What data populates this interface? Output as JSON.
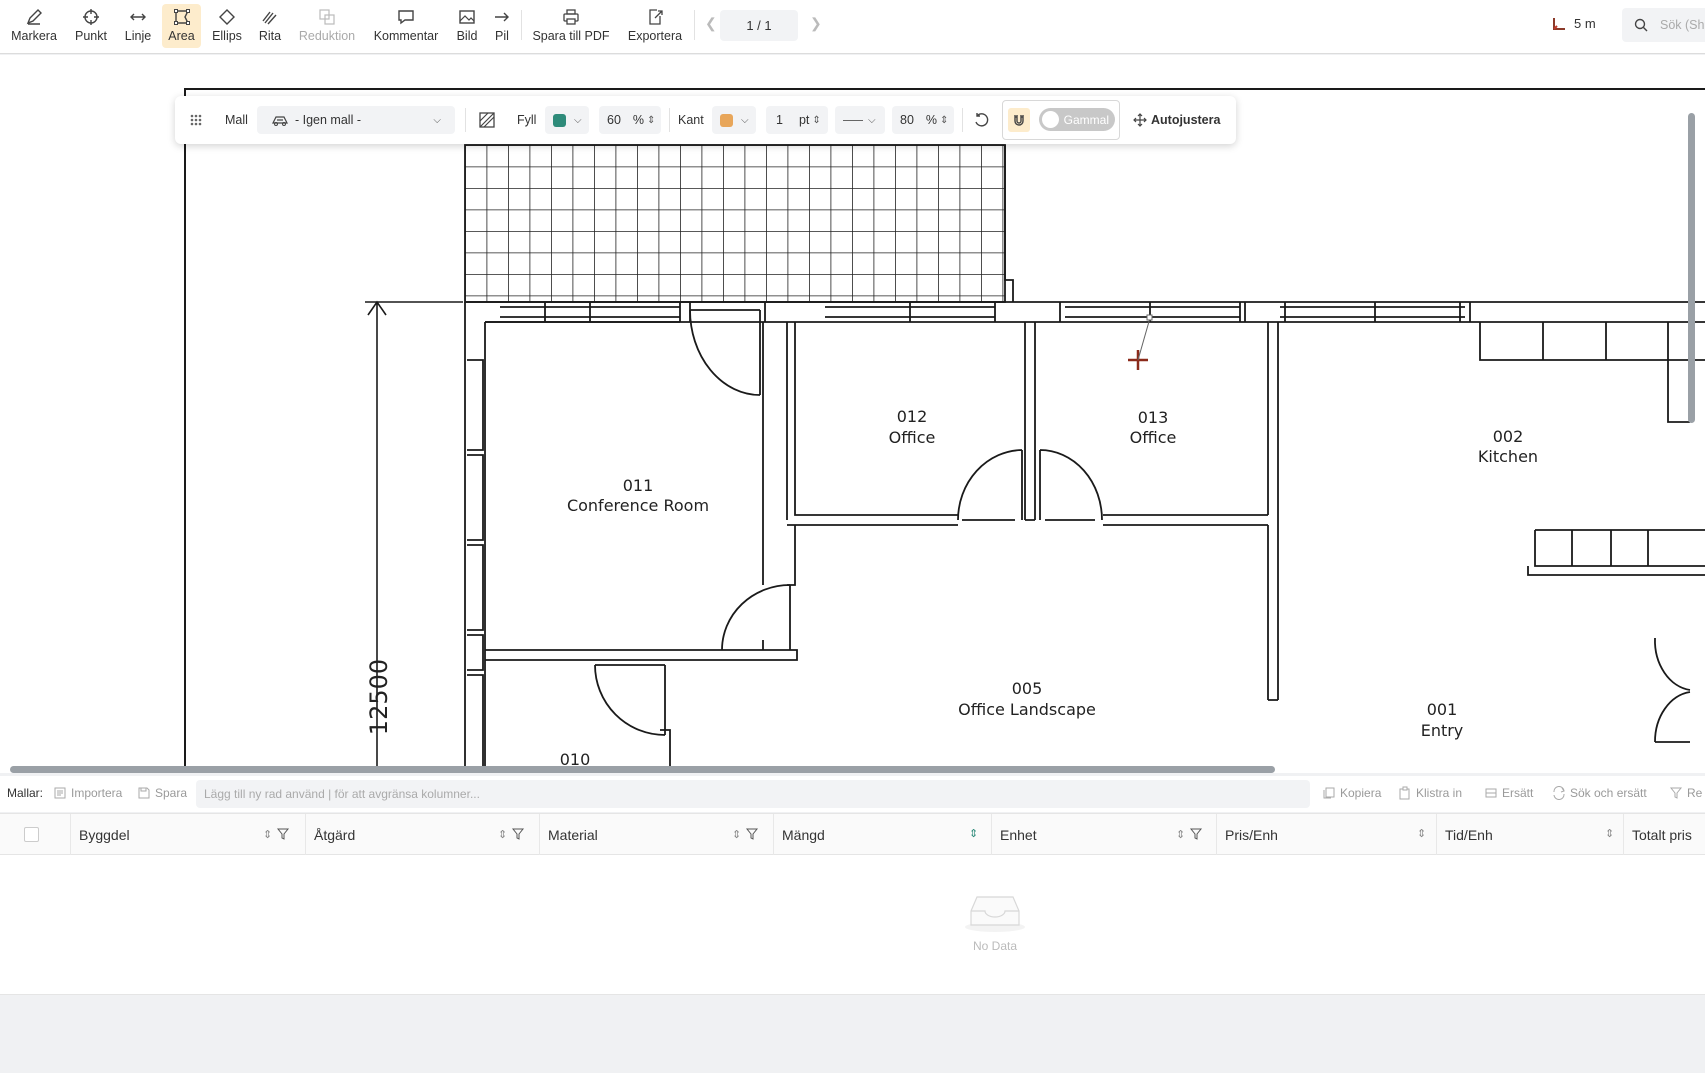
{
  "toolbar": {
    "tools": [
      {
        "label": "Markera",
        "icon": "pen-icon"
      },
      {
        "label": "Punkt",
        "icon": "crosshair-icon"
      },
      {
        "label": "Linje",
        "icon": "line-arrows-icon"
      },
      {
        "label": "Area",
        "icon": "area-polygon-icon",
        "active": true
      },
      {
        "label": "Ellips",
        "icon": "ellipse-icon"
      },
      {
        "label": "Rita",
        "icon": "draw-icon"
      },
      {
        "label": "Reduktion",
        "icon": "reduction-icon",
        "disabled": true
      },
      {
        "label": "Kommentar",
        "icon": "comment-icon"
      },
      {
        "label": "Bild",
        "icon": "image-icon"
      },
      {
        "label": "Pil",
        "icon": "arrow-icon"
      },
      {
        "label": "Spara till PDF",
        "icon": "printer-icon"
      },
      {
        "label": "Exportera",
        "icon": "export-icon"
      }
    ],
    "page_indicator": "1 / 1",
    "scale": "5 m",
    "search_placeholder": "Sök (Shift+F)"
  },
  "property_bar": {
    "template_label": "Mall",
    "template_value": "- Igen mall -",
    "fill_label": "Fyll",
    "fill_color": "#2e8b7a",
    "fill_opacity": "60",
    "percent": "%",
    "border_label": "Kant",
    "border_color": "#e8a65a",
    "border_width": "1",
    "border_unit": "pt",
    "border_opacity": "80",
    "toggle_label": "Gammal",
    "autofit_label": "Autojustera"
  },
  "floorplan": {
    "dimension": "12500",
    "rooms": [
      {
        "number": "011",
        "name": "Conference Room"
      },
      {
        "number": "012",
        "name": "Office"
      },
      {
        "number": "013",
        "name": "Office"
      },
      {
        "number": "002",
        "name": "Kitchen"
      },
      {
        "number": "005",
        "name": "Office Landscape"
      },
      {
        "number": "001",
        "name": "Entry"
      },
      {
        "number": "010",
        "name": ""
      }
    ]
  },
  "templates_bar": {
    "label": "Mallar:",
    "import": "Importera",
    "save": "Spara",
    "new_row_placeholder": "Lägg till ny rad använd | för att avgränsa kolumner...",
    "copy": "Kopiera",
    "paste": "Klistra in",
    "replace": "Ersätt",
    "find_replace": "Sök och ersätt",
    "remove": "Re"
  },
  "table": {
    "columns": [
      "Byggdel",
      "Åtgärd",
      "Material",
      "Mängd",
      "Enhet",
      "Pris/Enh",
      "Tid/Enh",
      "Totalt pris"
    ],
    "empty_text": "No Data"
  }
}
